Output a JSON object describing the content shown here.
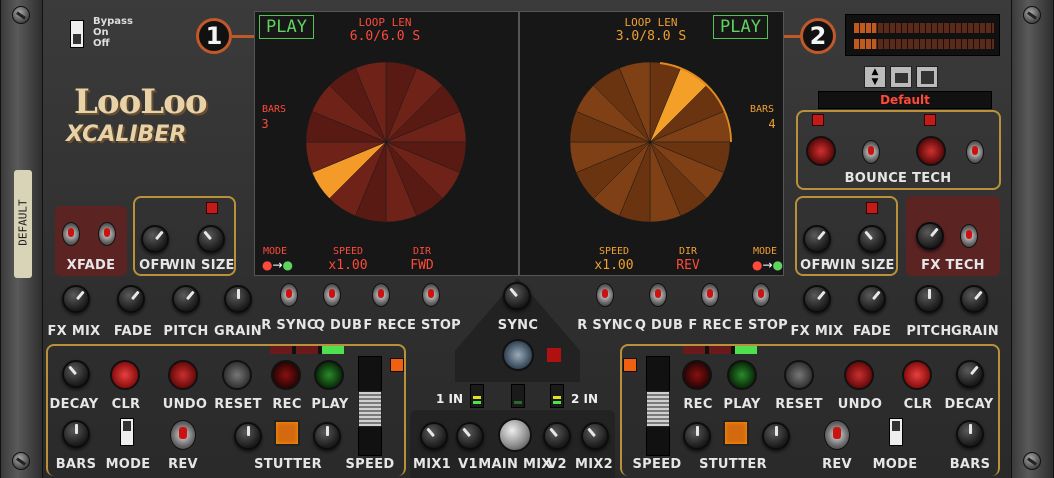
{
  "bypass": {
    "label": "Bypass",
    "on": "On",
    "off": "Off"
  },
  "side_label": "DEFAULT",
  "logo": {
    "top": "LooLoo",
    "bottom": "XCALIBER"
  },
  "preset": {
    "name": "Default"
  },
  "bounce_tech": "BOUNCE TECH",
  "deck1": {
    "number": "1",
    "play": "PLAY",
    "loop_len_label": "LOOP LEN",
    "loop_len": "6.0/6.0 S",
    "bars_label": "BARS",
    "bars": "3",
    "mode_label": "MODE",
    "speed_label": "SPEED",
    "speed": "x1.00",
    "dir_label": "DIR",
    "dir": "FWD"
  },
  "deck2": {
    "number": "2",
    "play": "PLAY",
    "loop_len_label": "LOOP LEN",
    "loop_len": "3.0/8.0 S",
    "bars_label": "BARS",
    "bars": "4",
    "mode_label": "MODE",
    "speed_label": "SPEED",
    "speed": "x1.00",
    "dir_label": "DIR",
    "dir": "REV"
  },
  "left": {
    "xfade": "XFADE",
    "off": "OFF",
    "win_size": "WIN SIZE",
    "fx_mix": "FX MIX",
    "fade": "FADE",
    "pitch": "PITCH",
    "grain": "GRAIN",
    "r_sync": "R SYNC",
    "q_dub": "Q DUB",
    "f_rec": "F REC",
    "e_stop": "E STOP",
    "decay": "DECAY",
    "clr": "CLR",
    "undo": "UNDO",
    "reset": "RESET",
    "rec": "REC",
    "play": "PLAY",
    "bars": "BARS",
    "mode": "MODE",
    "rev": "REV",
    "stutter": "STUTTER",
    "speed": "SPEED"
  },
  "right": {
    "fx_tech": "FX TECH",
    "off": "OFF",
    "win_size": "WIN SIZE",
    "fx_mix": "FX MIX",
    "fade": "FADE",
    "pitch": "PITCH",
    "grain": "GRAIN",
    "r_sync": "R SYNC",
    "q_dub": "Q DUB",
    "f_rec": "F REC",
    "e_stop": "E STOP",
    "decay": "DECAY",
    "clr": "CLR",
    "undo": "UNDO",
    "reset": "RESET",
    "rec": "REC",
    "play": "PLAY",
    "bars": "BARS",
    "mode": "MODE",
    "rev": "REV",
    "stutter": "STUTTER",
    "speed": "SPEED"
  },
  "center": {
    "sync": "SYNC",
    "in1": "1 IN",
    "in2": "2 IN",
    "mix1": "MIX1",
    "v1": "V1",
    "main_mix": "MAIN MIX",
    "v2": "V2",
    "mix2": "MIX2"
  },
  "colors": {
    "accent": "#b8913a",
    "play_green": "#5fd35f",
    "screen_red": "#ff4a3a",
    "screen_orange": "#f0a030"
  }
}
